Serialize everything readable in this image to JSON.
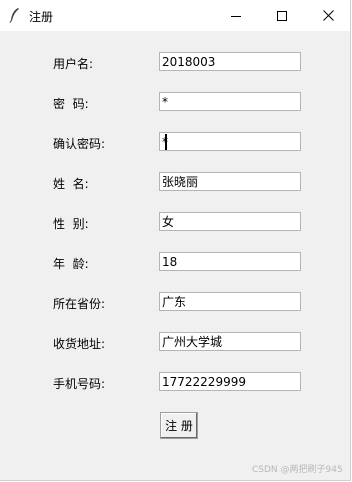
{
  "window": {
    "title": "注册",
    "icon": "feather-icon",
    "controls": [
      "minimize-icon",
      "maximize-icon",
      "close-icon"
    ]
  },
  "form": {
    "fields": [
      {
        "label": "用户名:",
        "value": "2018003"
      },
      {
        "label": "密  码:",
        "value": "*"
      },
      {
        "label": "确认密码:",
        "value": "*"
      },
      {
        "label": "姓  名:",
        "value": "张晓丽"
      },
      {
        "label": "性  别:",
        "value": "女"
      },
      {
        "label": "年  龄:",
        "value": "18"
      },
      {
        "label": "所在省份:",
        "value": "广东"
      },
      {
        "label": "收货地址:",
        "value": "广州大学城"
      },
      {
        "label": "手机号码:",
        "value": "17722229999"
      }
    ],
    "submit_label": "注 册"
  },
  "watermark": "CSDN @两把刷子945"
}
